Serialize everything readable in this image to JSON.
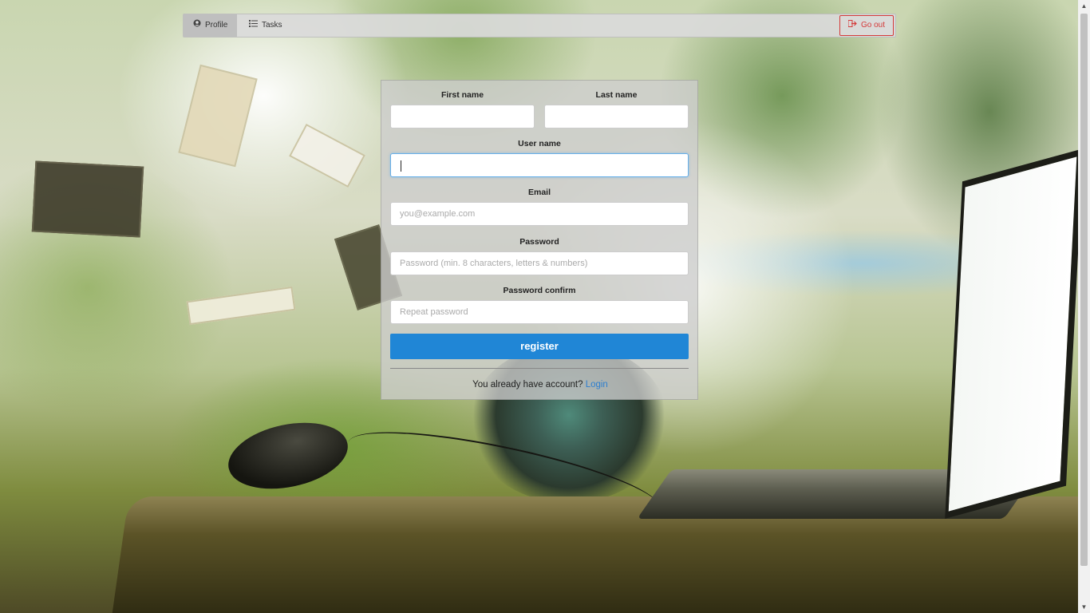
{
  "navbar": {
    "profile_label": "Profile",
    "tasks_label": "Tasks",
    "goout_label": "Go out",
    "profile_icon": "user-circle-icon",
    "tasks_icon": "list-icon",
    "goout_icon": "sign-out-icon"
  },
  "form": {
    "first_name_label": "First name",
    "last_name_label": "Last name",
    "username_label": "User name",
    "email_label": "Email",
    "email_placeholder": "you@example.com",
    "password_label": "Password",
    "password_placeholder": "Password (min. 8 characters, letters & numbers)",
    "password_confirm_label": "Password confirm",
    "password_confirm_placeholder": "Repeat password",
    "register_label": "register",
    "footer_text": "You already have account?",
    "login_link": "Login"
  },
  "colors": {
    "primary": "#2086d6",
    "danger": "#d43a3a",
    "link": "#2e7fcf"
  }
}
